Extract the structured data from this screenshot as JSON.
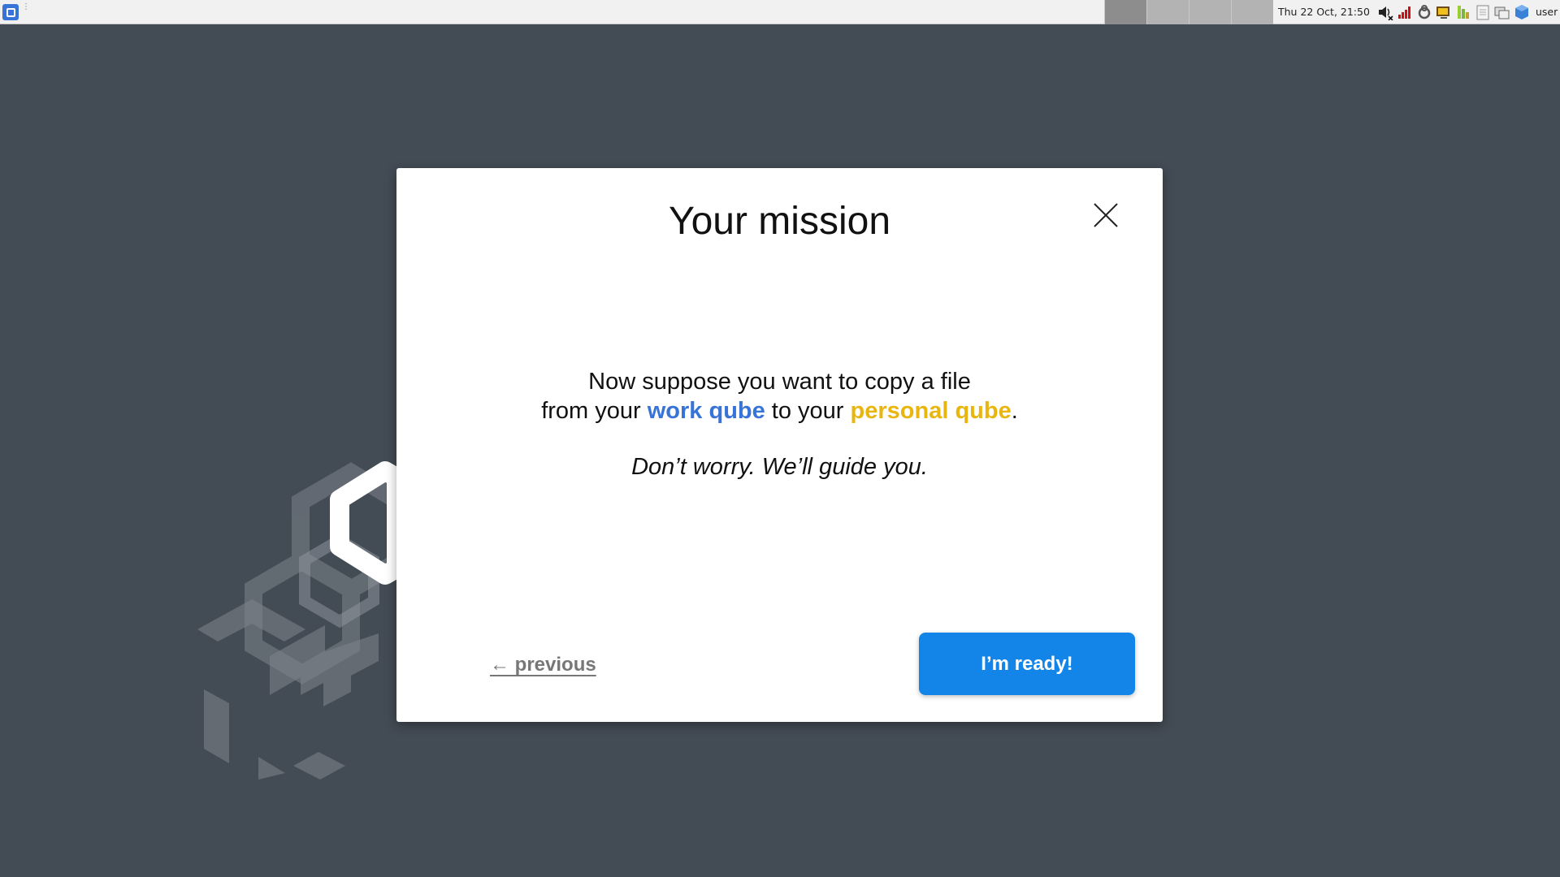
{
  "panel": {
    "clock": "Thu 22 Oct, 21:50",
    "user": "user",
    "workspaces": 4
  },
  "dialog": {
    "title": "Your mission",
    "line1": "Now suppose you want to copy a file",
    "line2_prefix": "from your ",
    "work_qube": "work qube",
    "line2_middle": " to your ",
    "personal_qube": "personal qube",
    "line2_suffix": ".",
    "guide": "Don’t worry. We’ll guide you.",
    "previous_label": "← previous",
    "ready_label": "I’m ready!"
  },
  "colors": {
    "work": "#3874d8",
    "personal": "#e8b60f",
    "primary_button": "#1485e8",
    "desktop": "#434b55"
  },
  "icons": {
    "menu": "qubes-menu-icon",
    "close": "close-icon",
    "volume": "volume-muted-icon",
    "network": "signal-bars-icon",
    "tray": [
      "qube-updater-icon",
      "devices-icon",
      "disk-icon",
      "clipboard-icon",
      "window-icon",
      "qube-domains-icon"
    ]
  }
}
